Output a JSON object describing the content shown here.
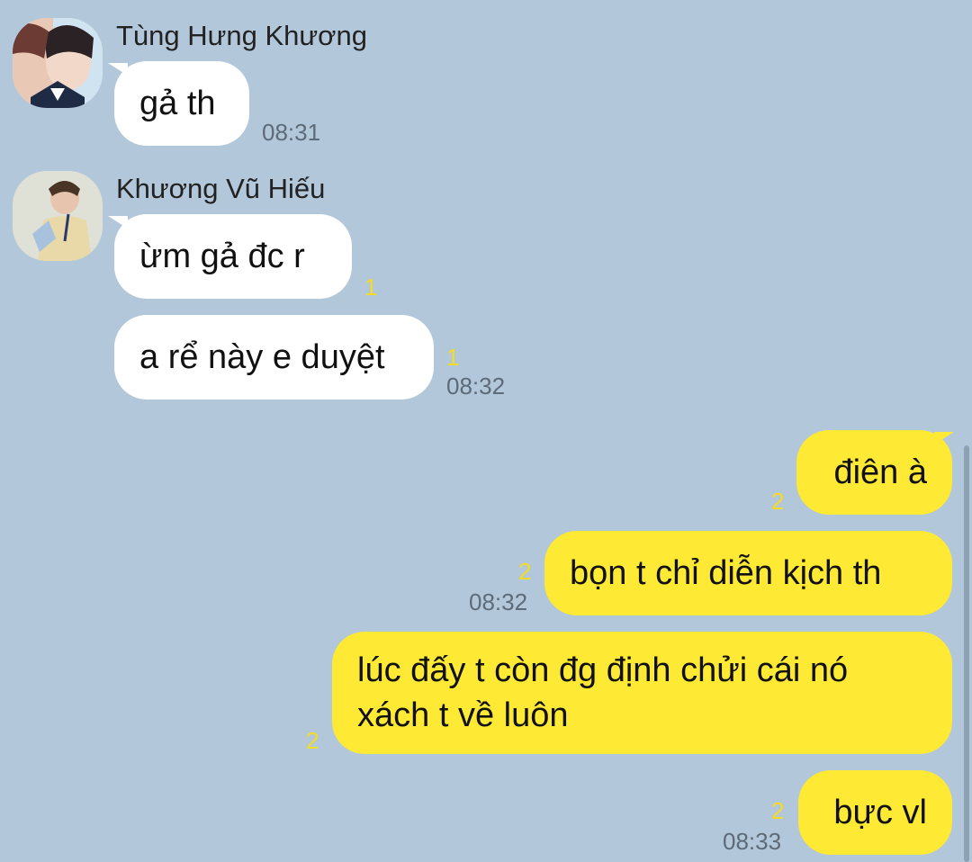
{
  "chat": {
    "messages_in": [
      {
        "sender": "Tùng Hưng Khương",
        "avatar_icon": "profile-photo",
        "bubbles": [
          {
            "text": "gả th",
            "unread": "",
            "time": "08:31"
          }
        ]
      },
      {
        "sender": "Khương Vũ Hiếu",
        "avatar_icon": "profile-photo",
        "bubbles": [
          {
            "text": "ừm gả đc r",
            "unread": "1",
            "time": ""
          },
          {
            "text": "a rể này e duyệt",
            "unread": "1",
            "time": "08:32"
          }
        ]
      }
    ],
    "messages_out": [
      {
        "text": "điên à",
        "unread": "2",
        "time": ""
      },
      {
        "text": "bọn t chỉ diễn kịch th",
        "unread": "2",
        "time": "08:32"
      },
      {
        "text": "lúc đấy t còn đg định chửi cái nó xách t về luôn",
        "unread": "2",
        "time": ""
      },
      {
        "text": "bực vl",
        "unread": "2",
        "time": "08:33"
      }
    ]
  },
  "colors": {
    "background": "#b2c7da",
    "incoming_bubble": "#ffffff",
    "outgoing_bubble": "#fee934",
    "unread_count": "#f5dc24",
    "timestamp": "#5d6b78"
  }
}
